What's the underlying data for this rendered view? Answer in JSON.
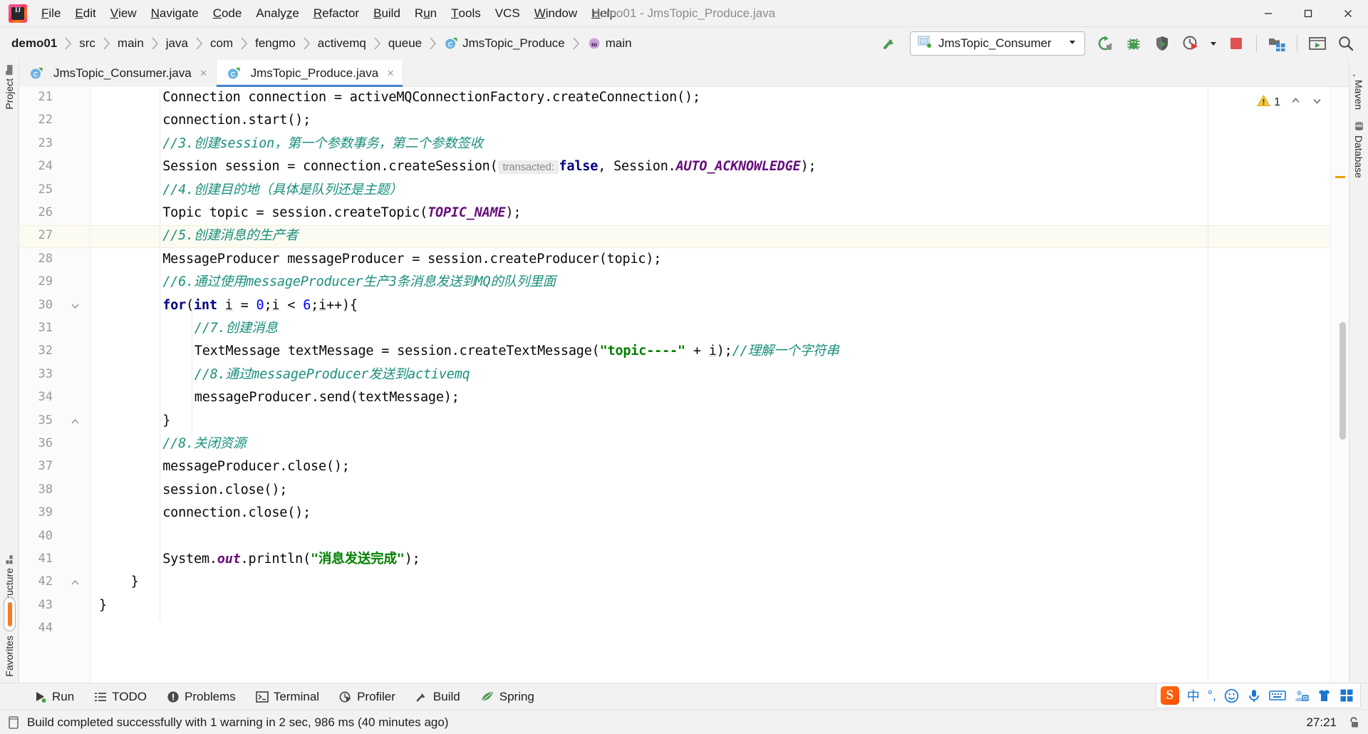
{
  "window": {
    "title": "demo01 - JmsTopic_Produce.java",
    "controls": {
      "minimize": "minimize",
      "maximize": "maximize",
      "close": "close"
    }
  },
  "menu": {
    "items": [
      {
        "label": "File",
        "mnemonic": "F"
      },
      {
        "label": "Edit",
        "mnemonic": "E"
      },
      {
        "label": "View",
        "mnemonic": "V"
      },
      {
        "label": "Navigate",
        "mnemonic": "N"
      },
      {
        "label": "Code",
        "mnemonic": "C"
      },
      {
        "label": "Analyze",
        "mnemonic": "z"
      },
      {
        "label": "Refactor",
        "mnemonic": "R"
      },
      {
        "label": "Build",
        "mnemonic": "B"
      },
      {
        "label": "Run",
        "mnemonic": "u"
      },
      {
        "label": "Tools",
        "mnemonic": "T"
      },
      {
        "label": "VCS",
        "mnemonic": ""
      },
      {
        "label": "Window",
        "mnemonic": "W"
      },
      {
        "label": "Help",
        "mnemonic": "H"
      }
    ]
  },
  "breadcrumb": {
    "items": [
      {
        "label": "demo01",
        "icon": "",
        "bold": true
      },
      {
        "label": "src",
        "icon": ""
      },
      {
        "label": "main",
        "icon": ""
      },
      {
        "label": "java",
        "icon": ""
      },
      {
        "label": "com",
        "icon": ""
      },
      {
        "label": "fengmo",
        "icon": ""
      },
      {
        "label": "activemq",
        "icon": ""
      },
      {
        "label": "queue",
        "icon": ""
      },
      {
        "label": "JmsTopic_Produce",
        "icon": "class-icon"
      },
      {
        "label": "main",
        "icon": "method-icon"
      }
    ]
  },
  "toolbar": {
    "build_hammer": "build-icon",
    "run_config": {
      "label": "JmsTopic_Consumer",
      "icon": "run-config-icon",
      "caret": "chevron-down-icon"
    },
    "buttons": [
      {
        "name": "rerun-icon",
        "title": "Rerun"
      },
      {
        "name": "debug-icon",
        "title": "Debug"
      },
      {
        "name": "coverage-icon",
        "title": "Run with Coverage"
      },
      {
        "name": "profiler-icon",
        "title": "Profiler"
      },
      {
        "name": "profiler-dropdown-icon",
        "title": "More"
      },
      {
        "name": "stop-icon",
        "title": "Stop"
      },
      {
        "name": "project-structure-icon",
        "title": "Project Structure"
      },
      {
        "name": "updates-icon",
        "title": "Updates"
      },
      {
        "name": "search-everywhere-icon",
        "title": "Search Everywhere"
      }
    ]
  },
  "left_rail": {
    "top": [
      {
        "label": "Project",
        "icon": "folder-icon"
      }
    ],
    "bottom": [
      {
        "label": "Structure",
        "icon": "structure-icon"
      },
      {
        "label": "Favorites",
        "icon": "star-icon"
      }
    ]
  },
  "right_rail": {
    "items": [
      {
        "label": "Maven",
        "icon": "maven-icon"
      },
      {
        "label": "Database",
        "icon": "database-icon"
      }
    ]
  },
  "tabs": [
    {
      "label": "JmsTopic_Consumer.java",
      "icon": "java-class-icon",
      "active": false,
      "close": "×"
    },
    {
      "label": "JmsTopic_Produce.java",
      "icon": "java-class-icon",
      "active": true,
      "close": "×"
    }
  ],
  "editor": {
    "inspection": {
      "warning_icon": "warning-triangle-icon",
      "count": "1",
      "prev": "chevron-up-icon",
      "next": "chevron-down-icon"
    },
    "highlight_line": 27,
    "first_line": 21,
    "lines": [
      {
        "n": 21,
        "indent": 8,
        "tokens": [
          {
            "t": "Connection connection = activeMQConnectionFactory.createConnection();",
            "c": "plain"
          }
        ]
      },
      {
        "n": 22,
        "indent": 8,
        "tokens": [
          {
            "t": "connection.start();",
            "c": "plain"
          }
        ]
      },
      {
        "n": 23,
        "indent": 8,
        "tokens": [
          {
            "t": "//3.创建session，第一个参数事务，第二个参数签收",
            "c": "cmt"
          }
        ]
      },
      {
        "n": 24,
        "indent": 8,
        "tokens": [
          {
            "t": "Session session = connection.createSession(",
            "c": "plain"
          },
          {
            "t": " transacted: ",
            "c": "hint"
          },
          {
            "t": "false",
            "c": "kw"
          },
          {
            "t": ", Session.",
            "c": "plain"
          },
          {
            "t": "AUTO_ACKNOWLEDGE",
            "c": "stat"
          },
          {
            "t": ");",
            "c": "plain"
          }
        ]
      },
      {
        "n": 25,
        "indent": 8,
        "tokens": [
          {
            "t": "//4.创建目的地（具体是队列还是主题）",
            "c": "cmt"
          }
        ]
      },
      {
        "n": 26,
        "indent": 8,
        "tokens": [
          {
            "t": "Topic topic = session.createTopic(",
            "c": "plain"
          },
          {
            "t": "TOPIC_NAME",
            "c": "fld"
          },
          {
            "t": ");",
            "c": "plain"
          }
        ]
      },
      {
        "n": 27,
        "indent": 8,
        "tokens": [
          {
            "t": "//5.创建消息的生产者",
            "c": "cmt"
          }
        ]
      },
      {
        "n": 28,
        "indent": 8,
        "tokens": [
          {
            "t": "MessageProducer messageProducer = session.createProducer(topic);",
            "c": "plain"
          }
        ]
      },
      {
        "n": 29,
        "indent": 8,
        "tokens": [
          {
            "t": "//6.通过使用messageProducer生产3条消息发送到MQ的队列里面",
            "c": "cmt"
          }
        ]
      },
      {
        "n": 30,
        "indent": 8,
        "fold": "open",
        "tokens": [
          {
            "t": "for",
            "c": "kw"
          },
          {
            "t": "(",
            "c": "plain"
          },
          {
            "t": "int",
            "c": "kw"
          },
          {
            "t": " ",
            "c": "plain"
          },
          {
            "t": "i",
            "c": "loc"
          },
          {
            "t": " = ",
            "c": "plain"
          },
          {
            "t": "0",
            "c": "num"
          },
          {
            "t": ";",
            "c": "plain"
          },
          {
            "t": "i",
            "c": "loc"
          },
          {
            "t": " < ",
            "c": "plain"
          },
          {
            "t": "6",
            "c": "num"
          },
          {
            "t": ";",
            "c": "plain"
          },
          {
            "t": "i",
            "c": "loc"
          },
          {
            "t": "++){",
            "c": "plain"
          }
        ]
      },
      {
        "n": 31,
        "indent": 12,
        "tokens": [
          {
            "t": "//7.创建消息",
            "c": "cmt"
          }
        ]
      },
      {
        "n": 32,
        "indent": 12,
        "tokens": [
          {
            "t": "TextMessage textMessage = session.createTextMessage(",
            "c": "plain"
          },
          {
            "t": "\"topic----\"",
            "c": "str"
          },
          {
            "t": " + ",
            "c": "plain"
          },
          {
            "t": "i",
            "c": "loc"
          },
          {
            "t": ");",
            "c": "plain"
          },
          {
            "t": "//理解一个字符串",
            "c": "cmt"
          }
        ]
      },
      {
        "n": 33,
        "indent": 12,
        "tokens": [
          {
            "t": "//8.通过messageProducer发送到activemq",
            "c": "cmt"
          }
        ]
      },
      {
        "n": 34,
        "indent": 12,
        "tokens": [
          {
            "t": "messageProducer.send(textMessage);",
            "c": "plain"
          }
        ]
      },
      {
        "n": 35,
        "indent": 8,
        "fold": "close",
        "tokens": [
          {
            "t": "}",
            "c": "plain"
          }
        ]
      },
      {
        "n": 36,
        "indent": 8,
        "tokens": [
          {
            "t": "//8.关闭资源",
            "c": "cmt"
          }
        ]
      },
      {
        "n": 37,
        "indent": 8,
        "tokens": [
          {
            "t": "messageProducer.close();",
            "c": "plain"
          }
        ]
      },
      {
        "n": 38,
        "indent": 8,
        "tokens": [
          {
            "t": "session.close();",
            "c": "plain"
          }
        ]
      },
      {
        "n": 39,
        "indent": 8,
        "tokens": [
          {
            "t": "connection.close();",
            "c": "plain"
          }
        ]
      },
      {
        "n": 40,
        "indent": 8,
        "tokens": [
          {
            "t": "",
            "c": "plain"
          }
        ]
      },
      {
        "n": 41,
        "indent": 8,
        "tokens": [
          {
            "t": "System.",
            "c": "plain"
          },
          {
            "t": "out",
            "c": "stat"
          },
          {
            "t": ".println(",
            "c": "plain"
          },
          {
            "t": "\"消息发送完成\"",
            "c": "str"
          },
          {
            "t": ");",
            "c": "plain"
          }
        ]
      },
      {
        "n": 42,
        "indent": 4,
        "fold": "close",
        "tokens": [
          {
            "t": "}",
            "c": "plain"
          }
        ]
      },
      {
        "n": 43,
        "indent": 0,
        "tokens": [
          {
            "t": "}",
            "c": "plain"
          }
        ]
      },
      {
        "n": 44,
        "indent": 0,
        "tokens": [
          {
            "t": "",
            "c": "plain"
          }
        ]
      }
    ]
  },
  "tool_windows": [
    {
      "label": "Run",
      "icon": "run-icon"
    },
    {
      "label": "TODO",
      "icon": "todo-icon"
    },
    {
      "label": "Problems",
      "icon": "problems-icon"
    },
    {
      "label": "Terminal",
      "icon": "terminal-icon"
    },
    {
      "label": "Profiler",
      "icon": "profiler-icon"
    },
    {
      "label": "Build",
      "icon": "build-icon"
    },
    {
      "label": "Spring",
      "icon": "spring-icon"
    }
  ],
  "status": {
    "icon": "build-status-icon",
    "message": "Build completed successfully with 1 warning in 2 sec, 986 ms (40 minutes ago)",
    "clock": "27:21",
    "lock_icon": "unlock-icon"
  },
  "ime": {
    "logo": "S",
    "items": [
      {
        "name": "chinese-mode-icon",
        "glyph": "中"
      },
      {
        "name": "punctuation-icon",
        "glyph": "°,"
      },
      {
        "name": "emoji-icon",
        "glyph": "☺"
      },
      {
        "name": "voice-input-icon",
        "glyph": "mic"
      },
      {
        "name": "soft-keyboard-icon",
        "glyph": "keyboard"
      },
      {
        "name": "user-icon",
        "glyph": "user"
      },
      {
        "name": "skin-icon",
        "glyph": "shirt"
      },
      {
        "name": "toolbox-icon",
        "glyph": "grid"
      }
    ]
  },
  "colors": {
    "accent_blue": "#4083c9",
    "warning_yellow": "#eda200",
    "green": "#4caf50",
    "stop_red": "#e05252",
    "comment_teal": "#1a8f7c",
    "keyword_navy": "#000080",
    "string_green": "#008000"
  }
}
